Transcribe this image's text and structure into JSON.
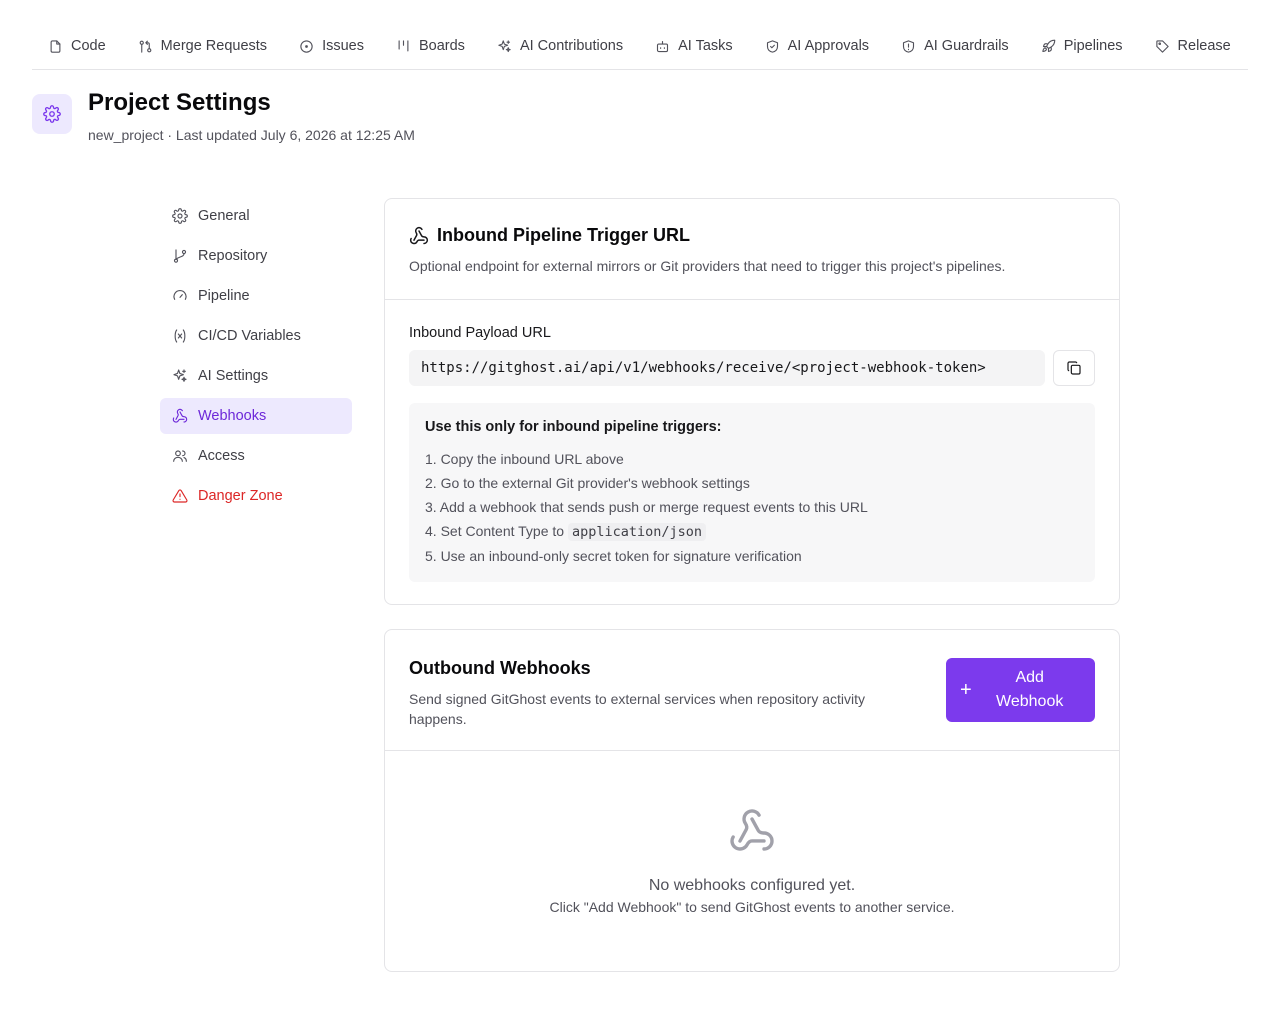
{
  "topnav": {
    "tabs": [
      {
        "label": "Code",
        "icon": "file-icon"
      },
      {
        "label": "Merge Requests",
        "icon": "merge-icon"
      },
      {
        "label": "Issues",
        "icon": "issue-circle-icon"
      },
      {
        "label": "Boards",
        "icon": "boards-icon"
      },
      {
        "label": "AI Contributions",
        "icon": "sparkles-icon"
      },
      {
        "label": "AI Tasks",
        "icon": "bot-icon"
      },
      {
        "label": "AI Approvals",
        "icon": "shield-check-icon"
      },
      {
        "label": "AI Guardrails",
        "icon": "shield-alert-icon"
      },
      {
        "label": "Pipelines",
        "icon": "rocket-icon"
      },
      {
        "label": "Release",
        "icon": "tag-icon"
      }
    ]
  },
  "header": {
    "title": "Project Settings",
    "subtitle": "new_project · Last updated July 6, 2026 at 12:25 AM",
    "icon": "gear-icon",
    "accent": "#7c3aed"
  },
  "sidebar": {
    "items": [
      {
        "label": "General",
        "icon": "gear-icon"
      },
      {
        "label": "Repository",
        "icon": "git-branch-icon"
      },
      {
        "label": "Pipeline",
        "icon": "gauge-icon"
      },
      {
        "label": "CI/CD Variables",
        "icon": "variable-icon"
      },
      {
        "label": "AI Settings",
        "icon": "sparkles-icon"
      },
      {
        "label": "Webhooks",
        "icon": "webhook-icon",
        "active": true
      },
      {
        "label": "Access",
        "icon": "users-icon"
      },
      {
        "label": "Danger Zone",
        "icon": "warning-triangle-icon",
        "color": "#dc2626"
      }
    ]
  },
  "inbound": {
    "title": "Inbound Pipeline Trigger URL",
    "description": "Optional endpoint for external mirrors or Git providers that need to trigger this project's pipelines.",
    "field_label": "Inbound Payload URL",
    "url": "https://gitghost.ai/api/v1/webhooks/receive/<project-webhook-token>",
    "instructions_title": "Use this only for inbound pipeline triggers:",
    "steps": {
      "s1": "1. Copy the inbound URL above",
      "s2": "2. Go to the external Git provider's webhook settings",
      "s3": "3. Add a webhook that sends push or merge request events to this URL",
      "s4_prefix": "4. Set Content Type to",
      "s4_code": "application/json",
      "s5": "5. Use an inbound-only secret token for signature verification"
    }
  },
  "outbound": {
    "title": "Outbound Webhooks",
    "description": "Send signed GitGhost events to external services when repository activity happens.",
    "add_button_icon": "+",
    "add_button_label": "Add Webhook",
    "empty_title": "No webhooks configured yet.",
    "empty_description": "Click \"Add Webhook\" to send GitGhost events to another service."
  }
}
